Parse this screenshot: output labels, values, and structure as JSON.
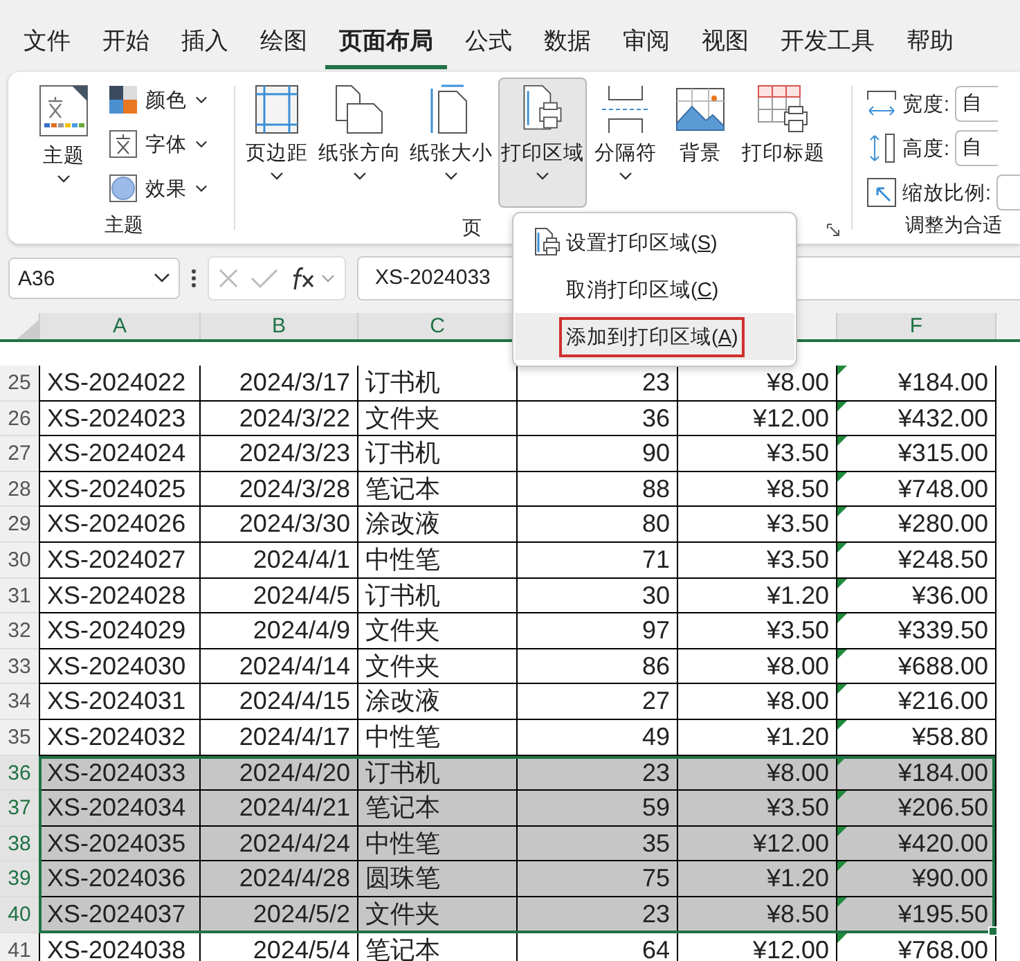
{
  "tabs": [
    {
      "label": "文件",
      "selected": false
    },
    {
      "label": "开始",
      "selected": false
    },
    {
      "label": "插入",
      "selected": false
    },
    {
      "label": "绘图",
      "selected": false
    },
    {
      "label": "页面布局",
      "selected": true
    },
    {
      "label": "公式",
      "selected": false
    },
    {
      "label": "数据",
      "selected": false
    },
    {
      "label": "审阅",
      "selected": false
    },
    {
      "label": "视图",
      "selected": false
    },
    {
      "label": "开发工具",
      "selected": false
    },
    {
      "label": "帮助",
      "selected": false
    }
  ],
  "theme_group": {
    "label": "主题",
    "big_button": "主题",
    "items": [
      {
        "label": "颜色",
        "kind": "colors"
      },
      {
        "label": "字体",
        "kind": "fonts"
      },
      {
        "label": "效果",
        "kind": "effects"
      }
    ]
  },
  "page_setup_group": {
    "label": "页",
    "buttons": [
      {
        "label": "页边距",
        "kind": "margins",
        "dropdown": true,
        "pressed": false
      },
      {
        "label": "纸张方向",
        "kind": "orientation",
        "dropdown": true,
        "pressed": false
      },
      {
        "label": "纸张大小",
        "kind": "size",
        "dropdown": true,
        "pressed": false
      },
      {
        "label": "打印区域",
        "kind": "print_area",
        "dropdown": true,
        "pressed": true
      },
      {
        "label": "分隔符",
        "kind": "breaks",
        "dropdown": true,
        "pressed": false
      },
      {
        "label": "背景",
        "kind": "background",
        "dropdown": false,
        "pressed": false
      },
      {
        "label": "打印标题",
        "kind": "print_titles",
        "dropdown": false,
        "pressed": false
      }
    ]
  },
  "scale_group": {
    "label": "调整为合适",
    "rows": [
      {
        "label": "宽度:",
        "value": "自",
        "kind": "width"
      },
      {
        "label": "高度:",
        "value": "自",
        "kind": "height"
      },
      {
        "label": "缩放比例:",
        "kind": "scale"
      }
    ]
  },
  "formula_bar": {
    "name_box": "A36",
    "formula": "XS-2024033"
  },
  "menu": {
    "items": [
      {
        "before": "设置打印区域(",
        "key": "S",
        "after": ")",
        "kind": "icon",
        "selected": false
      },
      {
        "before": "取消打印区域(",
        "key": "C",
        "after": ")",
        "kind": "plain",
        "selected": false
      },
      {
        "before": "添加到打印区域(",
        "key": "A",
        "after": ")",
        "kind": "plain",
        "selected": true
      }
    ]
  },
  "sheet": {
    "columns": [
      {
        "label": "A",
        "selected": true
      },
      {
        "label": "B",
        "selected": true
      },
      {
        "label": "C",
        "selected": true
      },
      null,
      null,
      {
        "label": "F",
        "selected": true
      }
    ],
    "rows": [
      {
        "num": "25",
        "cells": [
          "XS-2024022",
          "2024/3/17",
          "订书机",
          "23",
          "¥8.00",
          "¥184.00"
        ],
        "selected": false,
        "flagged": true
      },
      {
        "num": "26",
        "cells": [
          "XS-2024023",
          "2024/3/22",
          "文件夹",
          "36",
          "¥12.00",
          "¥432.00"
        ],
        "selected": false,
        "flagged": true
      },
      {
        "num": "27",
        "cells": [
          "XS-2024024",
          "2024/3/23",
          "订书机",
          "90",
          "¥3.50",
          "¥315.00"
        ],
        "selected": false,
        "flagged": true
      },
      {
        "num": "28",
        "cells": [
          "XS-2024025",
          "2024/3/28",
          "笔记本",
          "88",
          "¥8.50",
          "¥748.00"
        ],
        "selected": false,
        "flagged": true
      },
      {
        "num": "29",
        "cells": [
          "XS-2024026",
          "2024/3/30",
          "涂改液",
          "80",
          "¥3.50",
          "¥280.00"
        ],
        "selected": false,
        "flagged": true
      },
      {
        "num": "30",
        "cells": [
          "XS-2024027",
          "2024/4/1",
          "中性笔",
          "71",
          "¥3.50",
          "¥248.50"
        ],
        "selected": false,
        "flagged": true
      },
      {
        "num": "31",
        "cells": [
          "XS-2024028",
          "2024/4/5",
          "订书机",
          "30",
          "¥1.20",
          "¥36.00"
        ],
        "selected": false,
        "flagged": true
      },
      {
        "num": "32",
        "cells": [
          "XS-2024029",
          "2024/4/9",
          "文件夹",
          "97",
          "¥3.50",
          "¥339.50"
        ],
        "selected": false,
        "flagged": true
      },
      {
        "num": "33",
        "cells": [
          "XS-2024030",
          "2024/4/14",
          "文件夹",
          "86",
          "¥8.00",
          "¥688.00"
        ],
        "selected": false,
        "flagged": true
      },
      {
        "num": "34",
        "cells": [
          "XS-2024031",
          "2024/4/15",
          "涂改液",
          "27",
          "¥8.00",
          "¥216.00"
        ],
        "selected": false,
        "flagged": true
      },
      {
        "num": "35",
        "cells": [
          "XS-2024032",
          "2024/4/17",
          "中性笔",
          "49",
          "¥1.20",
          "¥58.80"
        ],
        "selected": false,
        "flagged": true
      },
      {
        "num": "36",
        "cells": [
          "XS-2024033",
          "2024/4/20",
          "订书机",
          "23",
          "¥8.00",
          "¥184.00"
        ],
        "selected": true,
        "flagged": true
      },
      {
        "num": "37",
        "cells": [
          "XS-2024034",
          "2024/4/21",
          "笔记本",
          "59",
          "¥3.50",
          "¥206.50"
        ],
        "selected": true,
        "flagged": true
      },
      {
        "num": "38",
        "cells": [
          "XS-2024035",
          "2024/4/24",
          "中性笔",
          "35",
          "¥12.00",
          "¥420.00"
        ],
        "selected": true,
        "flagged": true
      },
      {
        "num": "39",
        "cells": [
          "XS-2024036",
          "2024/4/28",
          "圆珠笔",
          "75",
          "¥1.20",
          "¥90.00"
        ],
        "selected": true,
        "flagged": true
      },
      {
        "num": "40",
        "cells": [
          "XS-2024037",
          "2024/5/2",
          "文件夹",
          "23",
          "¥8.50",
          "¥195.50"
        ],
        "selected": true,
        "flagged": true
      },
      {
        "num": "41",
        "cells": [
          "XS-2024038",
          "2024/5/4",
          "笔记本",
          "64",
          "¥12.00",
          "¥768.00"
        ],
        "selected": false,
        "flagged": true
      }
    ]
  }
}
